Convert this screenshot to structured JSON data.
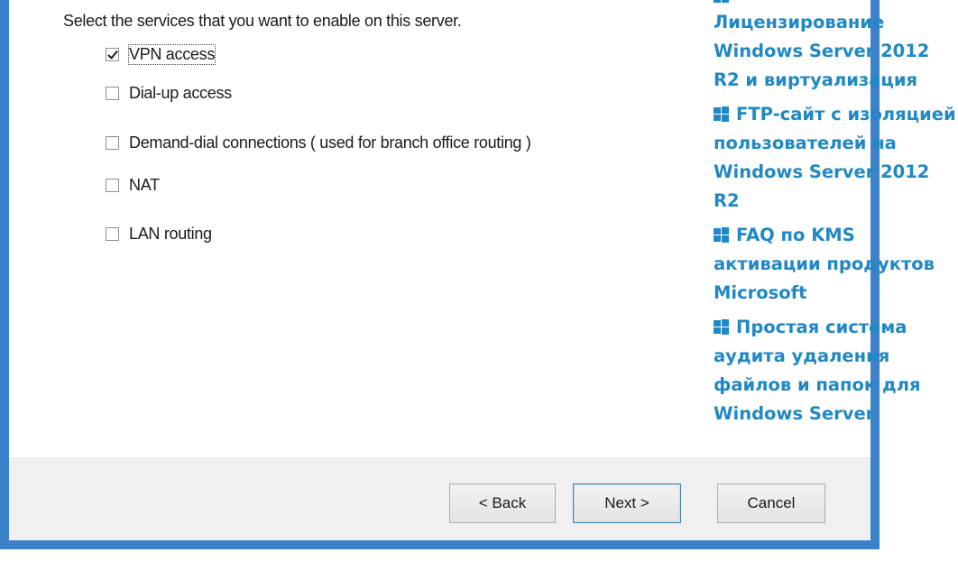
{
  "dialog": {
    "instruction": "Select the services that you want to enable on this server.",
    "options": [
      {
        "label": "VPN access",
        "checked": true
      },
      {
        "label": "Dial-up access",
        "checked": false
      },
      {
        "label": "Demand-dial connections ( used for branch office routing )",
        "checked": false
      },
      {
        "label": "NAT",
        "checked": false
      },
      {
        "label": "LAN routing",
        "checked": false
      }
    ],
    "buttons": {
      "back": "< Back",
      "next": "Next >",
      "cancel": "Cancel"
    }
  },
  "sidebar": {
    "links": [
      "Лицензирование Windows Server 2012 R2 и виртуализация",
      "FTP-сайт с изоляцией пользователей на Windows Server 2012 R2",
      "FAQ по KMS активации продуктов Microsoft",
      "Простая система аудита удаления файлов и папок для Windows Server"
    ],
    "icon": "windows-logo-icon",
    "link_color": "#1f88c5"
  }
}
